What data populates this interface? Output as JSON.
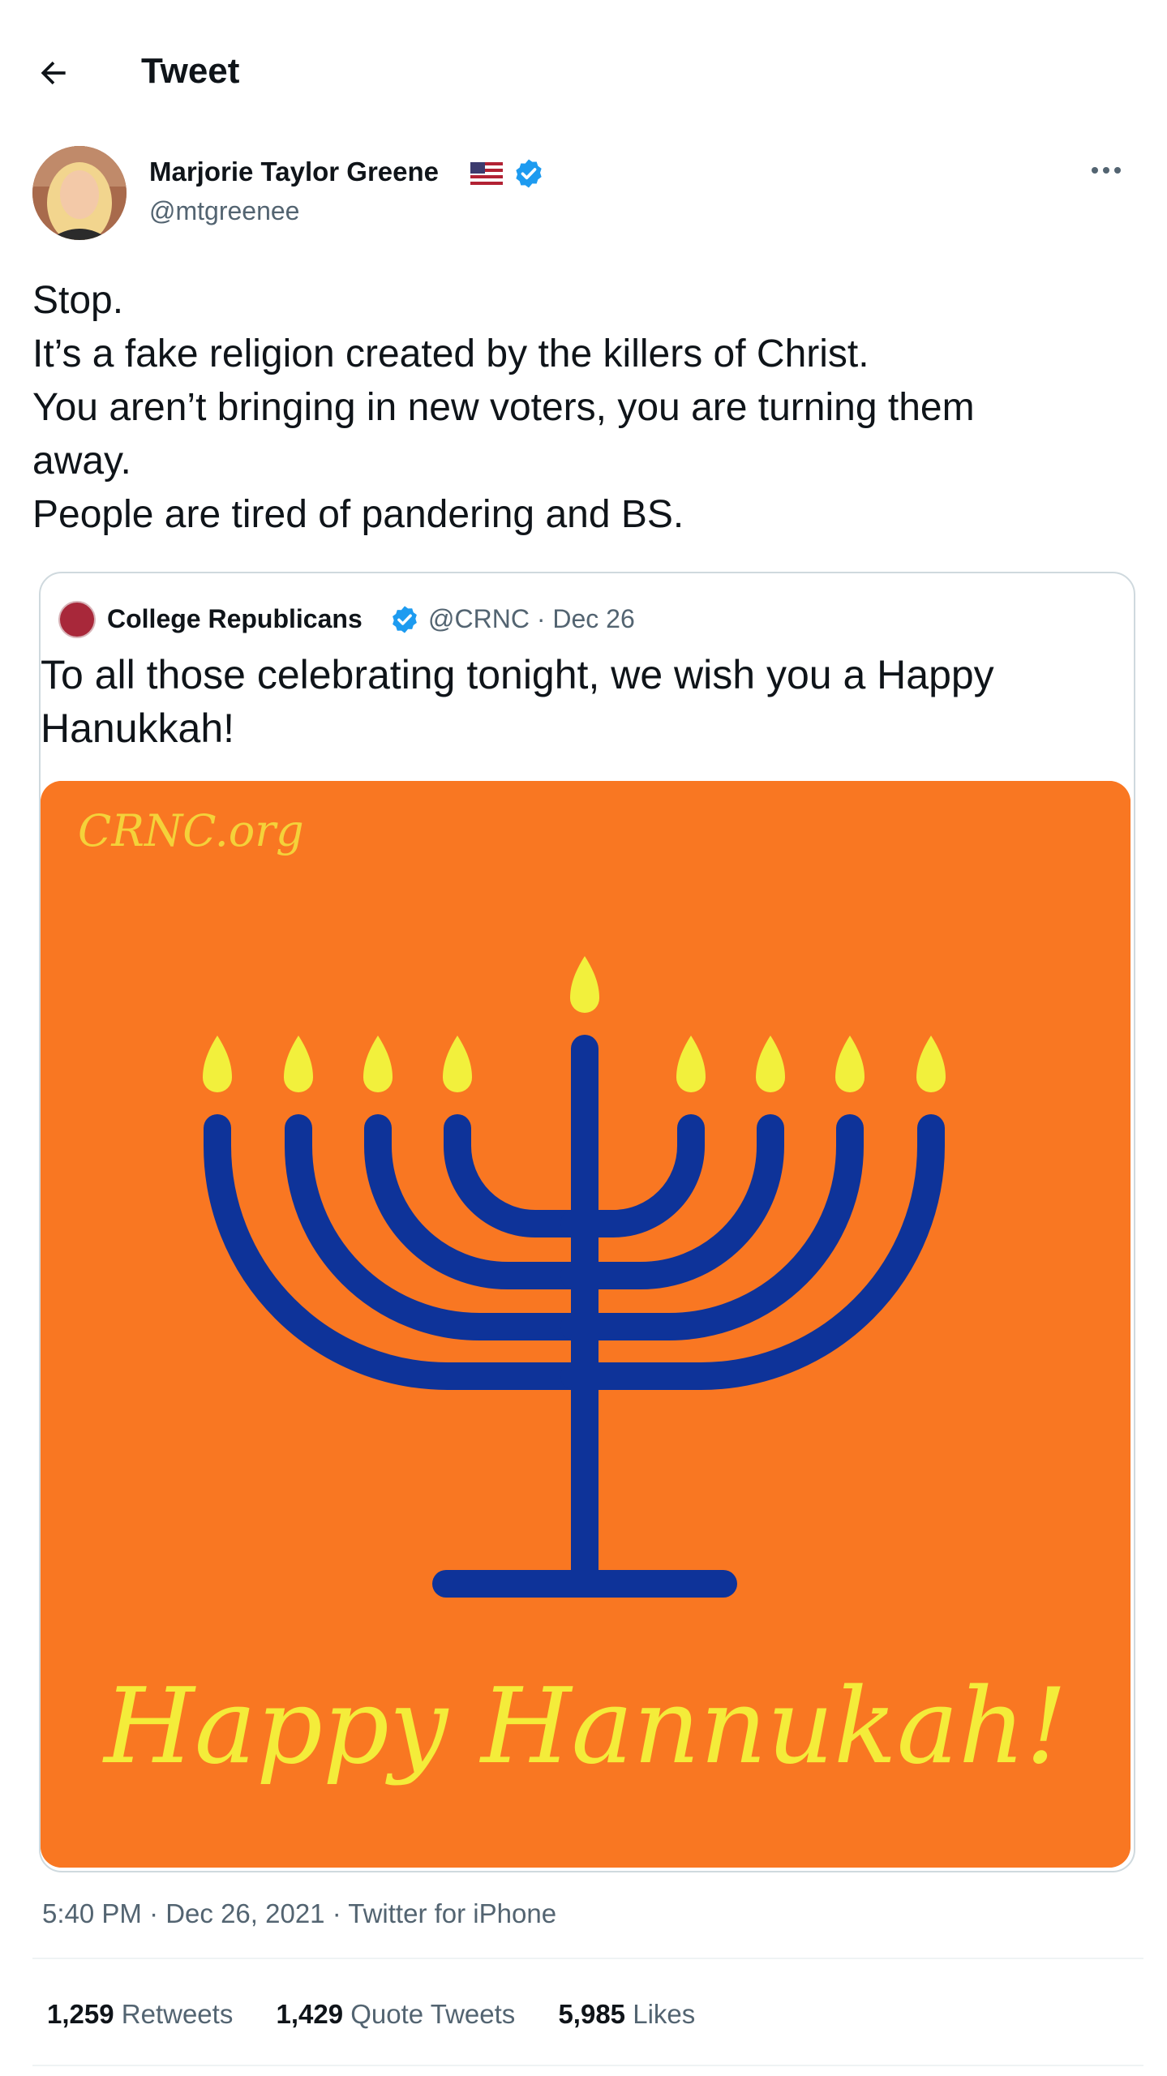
{
  "header": {
    "title": "Tweet"
  },
  "author": {
    "name": "Marjorie Taylor Greene",
    "handle": "@mtgreenee",
    "flag": "us-flag-icon",
    "verified": true
  },
  "tweet": {
    "lines": [
      "Stop.",
      "It’s a fake religion created by the killers of Christ.",
      "You aren’t bringing in new voters, you are turning them",
      "away.",
      "People are tired of pandering and BS."
    ]
  },
  "quote": {
    "name": "College Republicans",
    "handle_date": "@CRNC · Dec 26",
    "lines": [
      "To all those celebrating tonight, we wish you a Happy",
      "Hanukkah!"
    ],
    "image": {
      "watermark": "CRNC.org",
      "caption": "Happy Hannukah!",
      "background": "#f97722",
      "menorah_color": "#0e3399",
      "flame_color": "#f2f03c"
    }
  },
  "timestamp": "5:40 PM · Dec 26, 2021 · Twitter for iPhone",
  "stats": [
    {
      "count": "1,259",
      "label": "Retweets"
    },
    {
      "count": "1,429",
      "label": "Quote Tweets"
    },
    {
      "count": "5,985",
      "label": "Likes"
    }
  ],
  "colors": {
    "verified": "#1d9bf0",
    "secondary_text": "#536471"
  }
}
